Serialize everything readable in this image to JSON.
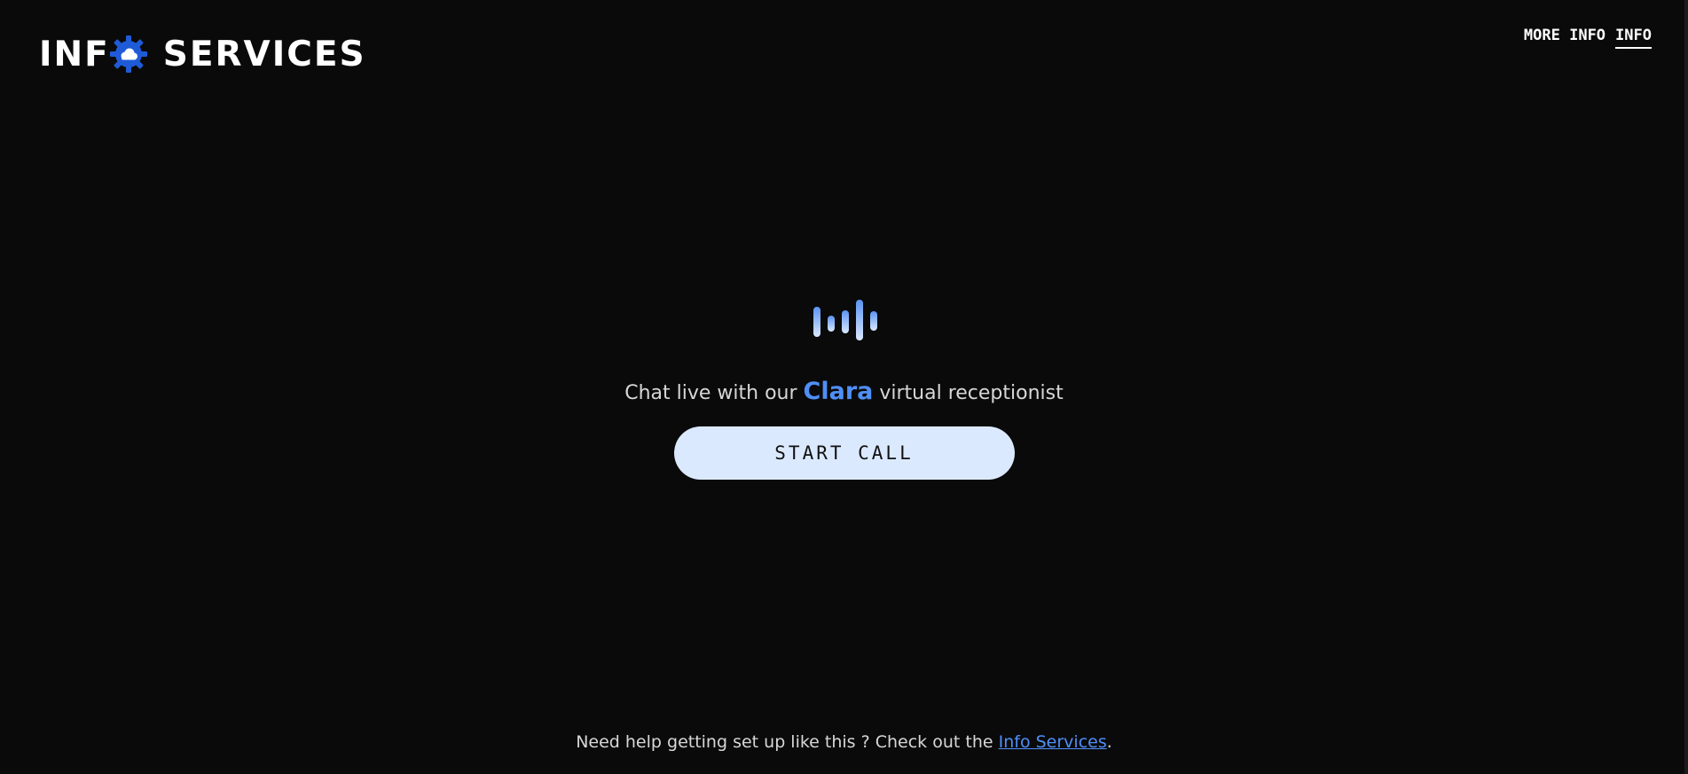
{
  "header": {
    "logo": {
      "word1": "INF",
      "word2": "SERVICES",
      "icon": "gear-cloud-icon"
    },
    "nav": [
      {
        "label": "MORE INFO",
        "active": false
      },
      {
        "label": "INFO",
        "active": true
      }
    ]
  },
  "hero": {
    "icon": "audio-wave-icon",
    "tagline_before": "Chat live with our ",
    "tagline_brand": "Clara",
    "tagline_after": " virtual receptionist",
    "button_label": "START CALL"
  },
  "footer": {
    "text_before": "Need help getting set up like this ? Check out the ",
    "link_label": "Info Services",
    "text_after": "."
  },
  "colors": {
    "background": "#0a0a0b",
    "accent": "#4f8ff7",
    "button_bg": "#dbe9ff"
  }
}
